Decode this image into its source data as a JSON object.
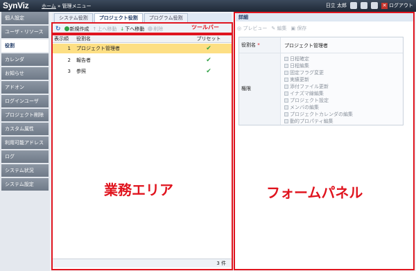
{
  "header": {
    "logo": "SynViz",
    "breadcrumb_home": "ホーム",
    "breadcrumb_sep": "»",
    "breadcrumb_current": "管理メニュー",
    "user": "日立 太郎",
    "logout": "ログアウト",
    "icons": [
      "home-icon",
      "window-icon",
      "help-icon"
    ]
  },
  "sidebar": {
    "items": [
      {
        "label": "個人設定"
      },
      {
        "label": "ユーザ・リソース"
      },
      {
        "label": "役割"
      },
      {
        "label": "カレンダ"
      },
      {
        "label": "お知らせ"
      },
      {
        "label": "アドオン"
      },
      {
        "label": "ログインユーザ"
      },
      {
        "label": "プロジェクト削除"
      },
      {
        "label": "カスタム属性"
      },
      {
        "label": "利用可能アドレス"
      },
      {
        "label": "ログ"
      },
      {
        "label": "システム状況"
      },
      {
        "label": "システム設定"
      }
    ],
    "active_index": 2
  },
  "tabs": [
    {
      "label": "システム役割"
    },
    {
      "label": "プロジェクト役割"
    },
    {
      "label": "プログラム役割"
    }
  ],
  "toolbar": {
    "new": "新規作成",
    "move_up": "上へ移動",
    "move_down": "下へ移動",
    "delete": "削除",
    "annotation": "ツールバー"
  },
  "grid": {
    "columns": [
      "表示順",
      "役割名",
      "プリセット"
    ],
    "rows": [
      {
        "order": "1",
        "name": "プロジェクト管理者",
        "preset": "✔"
      },
      {
        "order": "2",
        "name": "報告者",
        "preset": "✔"
      },
      {
        "order": "3",
        "name": "参照",
        "preset": "✔"
      }
    ],
    "status": "3 件",
    "annotation": "業務エリア"
  },
  "detail": {
    "title": "詳細",
    "preview": "プレビュー",
    "edit": "編集",
    "save": "保存",
    "role_name_label": "役割名",
    "required_mark": "*",
    "role_name_value": "プロジェクト管理者",
    "permissions_label": "権限",
    "permissions": [
      "日程確定",
      "日程編集",
      "固定フラグ変更",
      "実績更新",
      "添付ファイル更新",
      "イナズマ線編集",
      "プロジェクト設定",
      "メンバの編集",
      "プロジェクトカレンダの編集",
      "動的プロパティ編集"
    ],
    "annotation": "フォームパネル"
  },
  "colors": {
    "header_bg": "#2b3646",
    "highlight_red": "#e0141e",
    "selected_row": "#fddf84",
    "check_green": "#2ea043"
  }
}
